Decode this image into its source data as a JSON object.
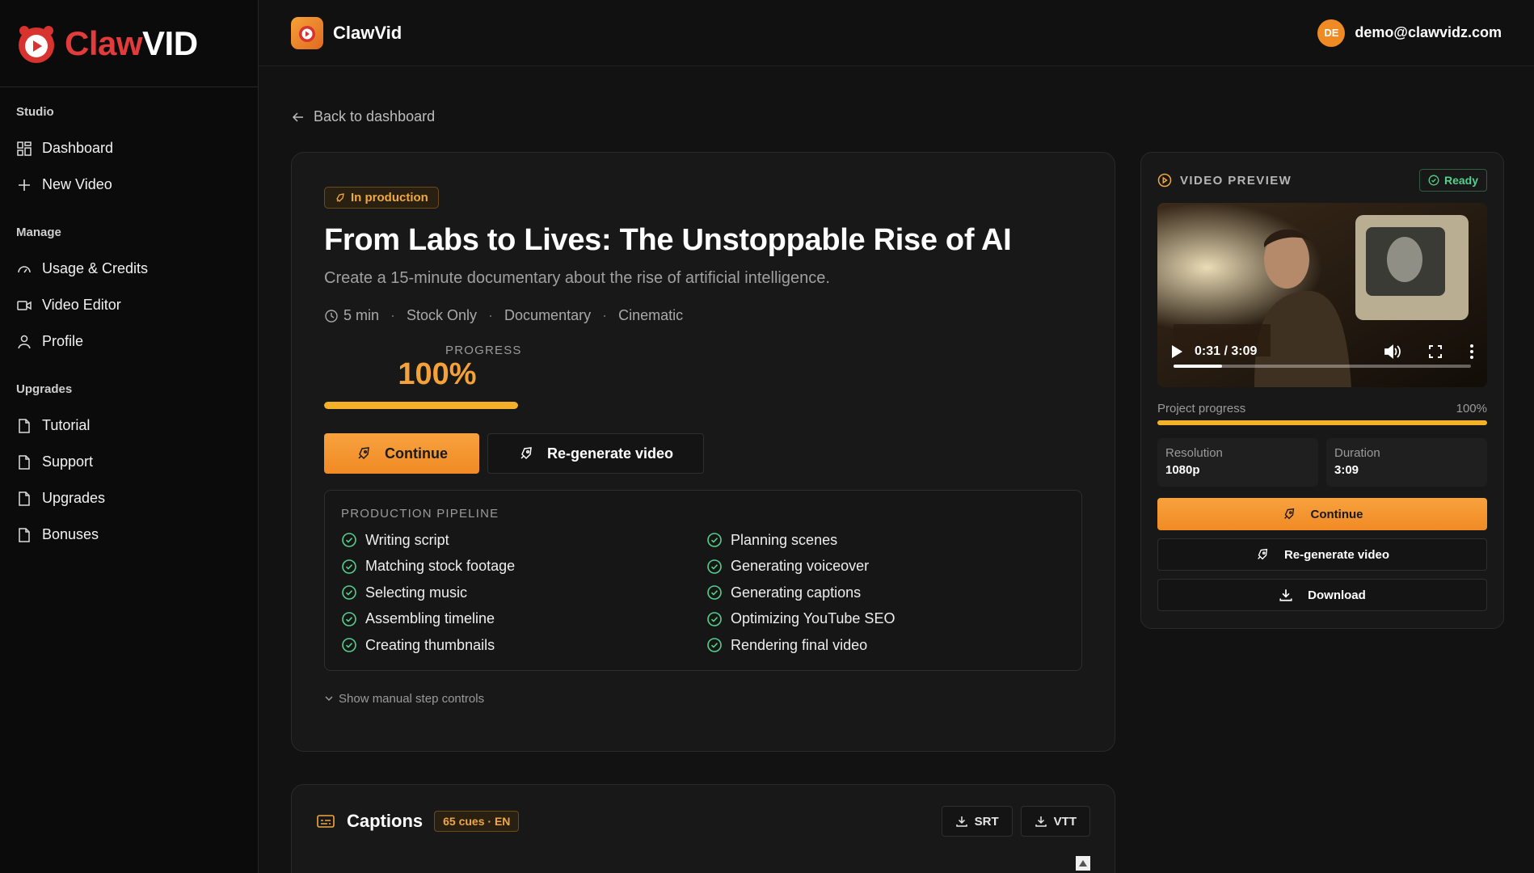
{
  "brand": {
    "name_part1": "Claw",
    "name_part2": "VID"
  },
  "topbar": {
    "app_title": "ClawVid",
    "user_initials": "DE",
    "user_email": "demo@clawvidz.com"
  },
  "sidebar": {
    "sections": [
      {
        "heading": "Studio",
        "items": [
          {
            "label": "Dashboard",
            "icon": "dashboard-icon"
          },
          {
            "label": "New Video",
            "icon": "plus-icon"
          }
        ]
      },
      {
        "heading": "Manage",
        "items": [
          {
            "label": "Usage & Credits",
            "icon": "gauge-icon"
          },
          {
            "label": "Video Editor",
            "icon": "video-camera-icon"
          },
          {
            "label": "Profile",
            "icon": "user-icon"
          }
        ]
      },
      {
        "heading": "Upgrades",
        "items": [
          {
            "label": "Tutorial",
            "icon": "document-icon"
          },
          {
            "label": "Support",
            "icon": "document-icon"
          },
          {
            "label": "Upgrades",
            "icon": "document-icon"
          },
          {
            "label": "Bonuses",
            "icon": "document-icon"
          }
        ]
      }
    ]
  },
  "back_link": "Back to dashboard",
  "project": {
    "status": "In production",
    "title": "From Labs to Lives: The Unstoppable Rise of AI",
    "description": "Create a 15-minute documentary about the rise of artificial intelligence.",
    "meta": {
      "duration": "5 min",
      "footage": "Stock Only",
      "genre": "Documentary",
      "style": "Cinematic"
    },
    "progress_label": "PROGRESS",
    "progress_value": "100%",
    "progress_fraction": 1.0,
    "continue_label": "Continue",
    "regenerate_label": "Re-generate video",
    "pipeline_heading": "PRODUCTION PIPELINE",
    "pipeline_left": [
      "Writing script",
      "Matching stock footage",
      "Selecting music",
      "Assembling timeline",
      "Creating thumbnails"
    ],
    "pipeline_right": [
      "Planning scenes",
      "Generating voiceover",
      "Generating captions",
      "Optimizing YouTube SEO",
      "Rendering final video"
    ],
    "manual_toggle": "Show manual step controls"
  },
  "captions": {
    "title": "Captions",
    "cues": "65 cues · EN",
    "srt_label": "SRT",
    "vtt_label": "VTT"
  },
  "preview": {
    "title": "VIDEO PREVIEW",
    "status": "Ready",
    "time": "0:31 / 3:09",
    "played_fraction": 0.164,
    "project_progress_label": "Project progress",
    "project_progress_value": "100%",
    "project_progress_fraction": 1.0,
    "resolution_label": "Resolution",
    "resolution_value": "1080p",
    "duration_label": "Duration",
    "duration_value": "3:09",
    "continue_label": "Continue",
    "regenerate_label": "Re-generate video",
    "download_label": "Download"
  },
  "colors": {
    "accent": "#F5A13A",
    "success": "#55D08C",
    "brand_red": "#E23B3B"
  }
}
